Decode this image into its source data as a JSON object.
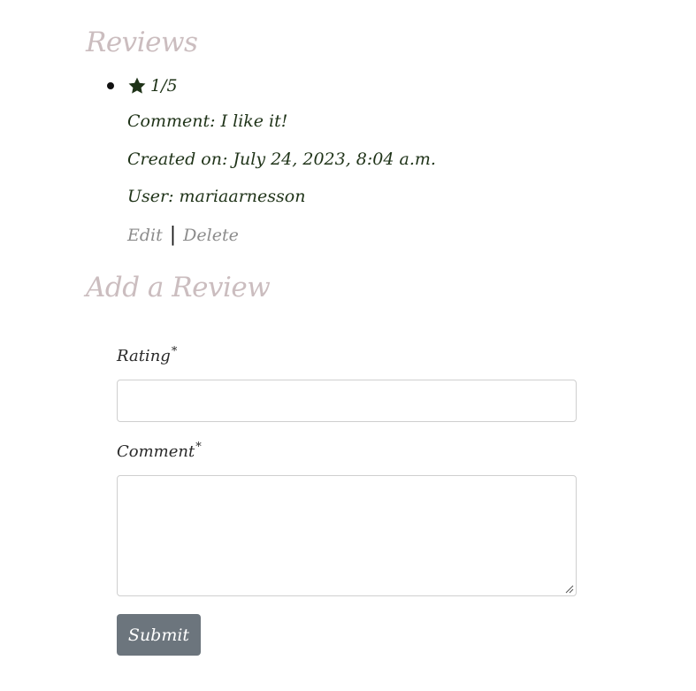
{
  "reviews_section": {
    "heading": "Reviews",
    "reviews": [
      {
        "rating_icon": "star-icon",
        "rating": "1/5",
        "comment": "Comment: I like it!",
        "created_on": "Created on: July 24, 2023, 8:04 a.m.",
        "user": "User: mariaarnesson",
        "edit_label": "Edit",
        "separator": "|",
        "delete_label": "Delete"
      }
    ]
  },
  "add_review_section": {
    "heading": "Add a Review",
    "rating_label": "Rating",
    "rating_required": "*",
    "rating_value": "",
    "comment_label": "Comment",
    "comment_required": "*",
    "comment_value": "",
    "submit_label": "Submit"
  },
  "colors": {
    "heading": "#cbbdbf",
    "text": "#1f3318",
    "link": "#8c8c8c",
    "button": "#6c757d"
  }
}
